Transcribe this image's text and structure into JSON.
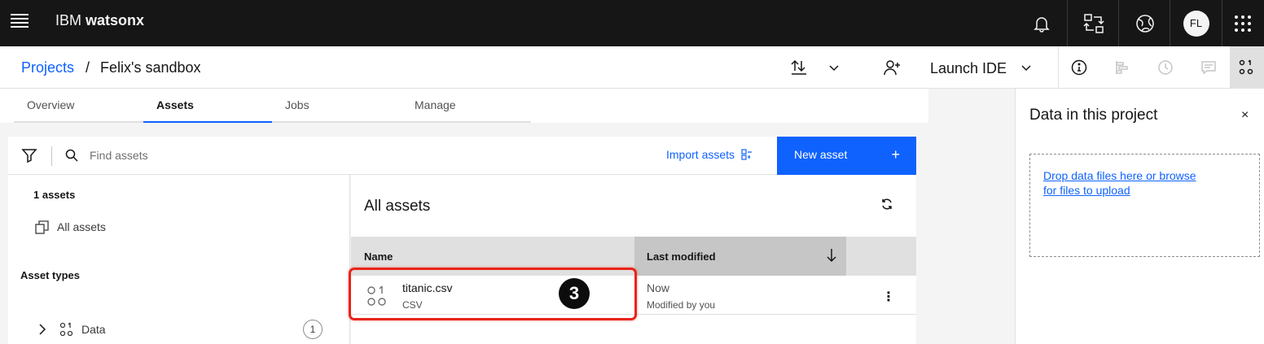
{
  "topbar": {
    "brand_prefix": "IBM",
    "brand_name": "watsonx",
    "avatar_initials": "FL"
  },
  "breadcrumb": {
    "projects": "Projects",
    "separator": "/",
    "current": "Felix's sandbox"
  },
  "header": {
    "launch_ide": "Launch IDE"
  },
  "tabs": [
    {
      "label": "Overview"
    },
    {
      "label": "Assets"
    },
    {
      "label": "Jobs"
    },
    {
      "label": "Manage"
    }
  ],
  "toolbar": {
    "search_placeholder": "Find assets",
    "import_label": "Import assets",
    "new_asset_label": "New asset",
    "new_asset_plus": "+"
  },
  "left_panel": {
    "count": "1 assets",
    "all_assets": "All assets",
    "asset_types_heading": "Asset types",
    "data_type_label": "Data",
    "data_type_count": "1"
  },
  "main_panel": {
    "title": "All assets",
    "columns": {
      "name": "Name",
      "last_modified": "Last modified"
    },
    "rows": [
      {
        "name": "titanic.csv",
        "type": "CSV",
        "modified": "Now",
        "modified_by": "Modified by you"
      }
    ],
    "step_badge": "3"
  },
  "right_panel": {
    "title": "Data in this project",
    "close": "×",
    "dropzone_text": "Drop data files here or browse for files to upload"
  },
  "colors": {
    "accent": "#0f62fe",
    "topbar_bg": "#161616",
    "highlight": "#e8251b"
  }
}
